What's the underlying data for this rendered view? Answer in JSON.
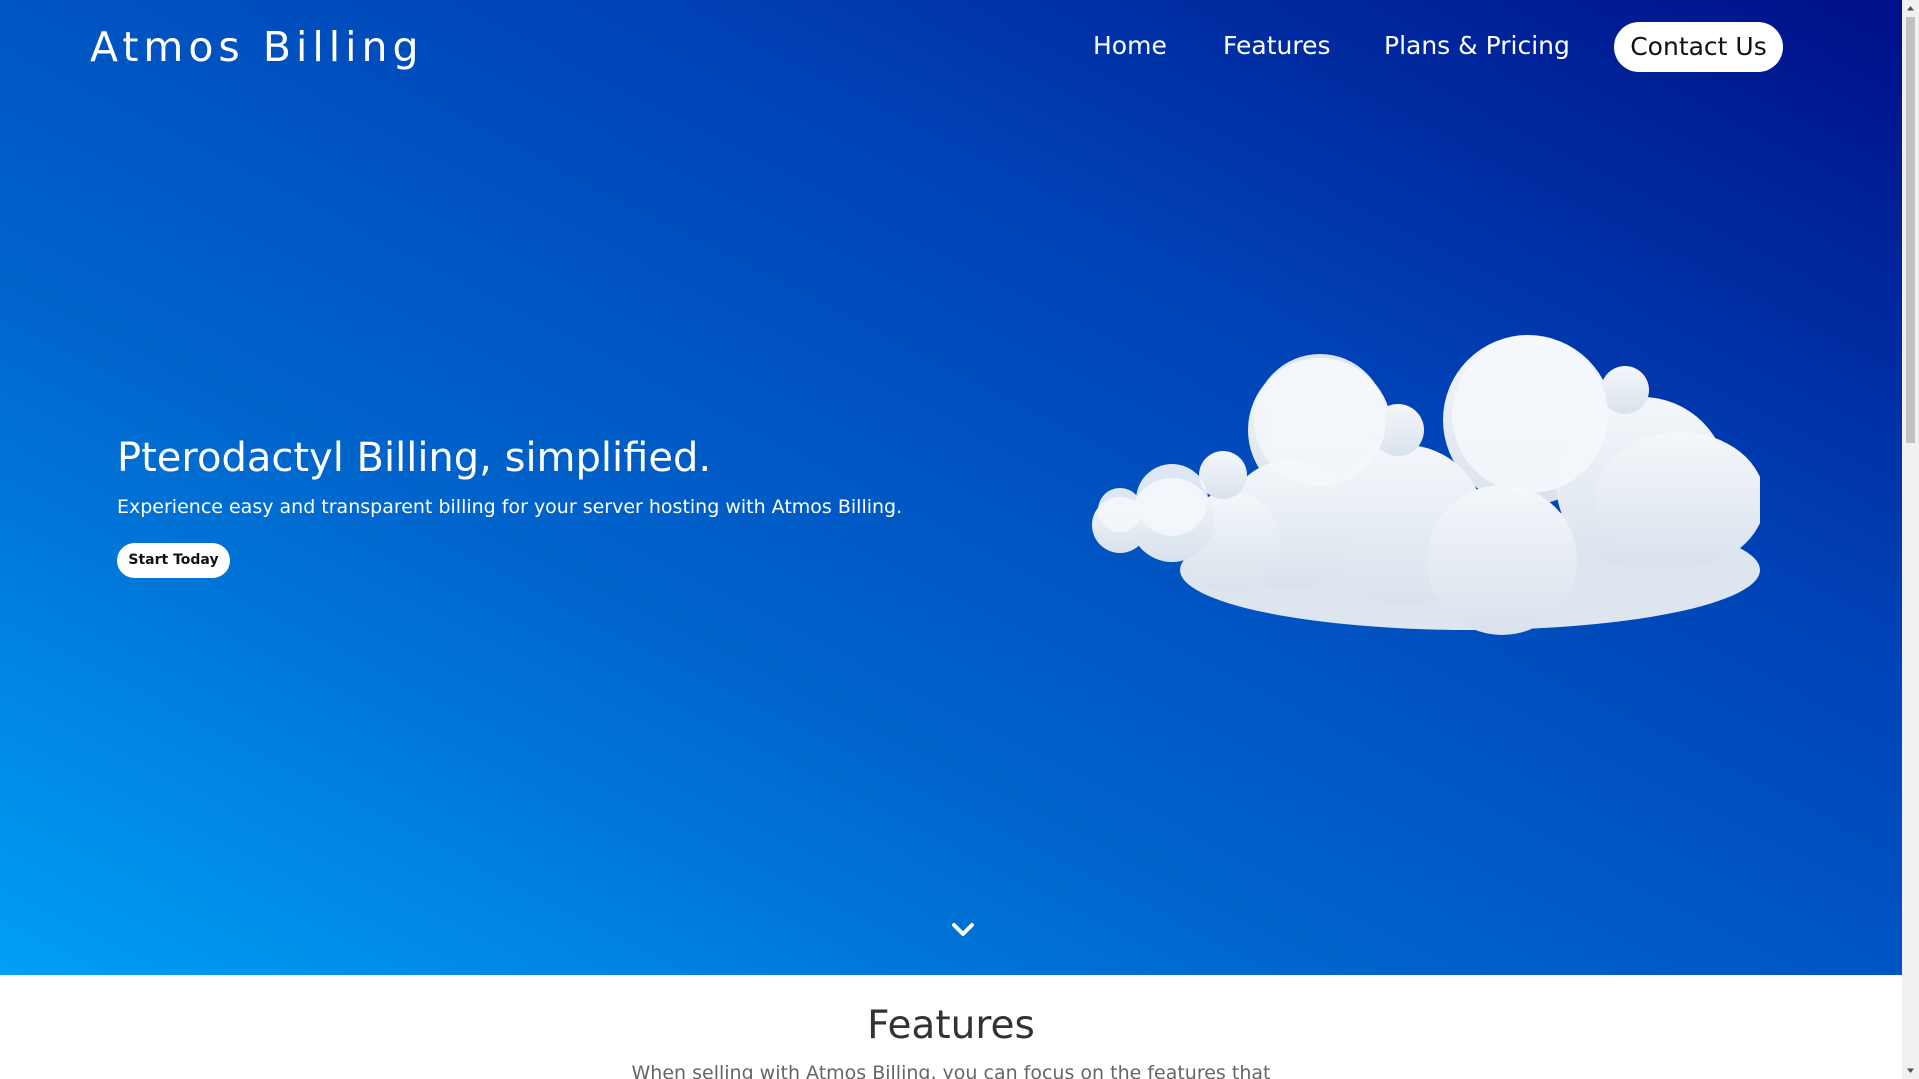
{
  "nav": {
    "brand": "Atmos Billing",
    "links": [
      "Home",
      "Features",
      "Plans & Pricing"
    ],
    "contact_label": "Contact Us"
  },
  "hero": {
    "title": "Pterodactyl Billing, simplified.",
    "subtitle": "Experience easy and transparent billing for your server hosting with Atmos Billing.",
    "cta_label": "Start Today",
    "illustration": "cloud-illustration",
    "scroll_icon": "chevron-down-icon"
  },
  "features": {
    "title": "Features",
    "subtitle": "When selling with Atmos Billing, you can focus on the features that"
  },
  "colors": {
    "gradient_start": "#00a0f4",
    "gradient_end": "#000f88",
    "button_bg": "#ffffff",
    "button_text": "#111111"
  }
}
